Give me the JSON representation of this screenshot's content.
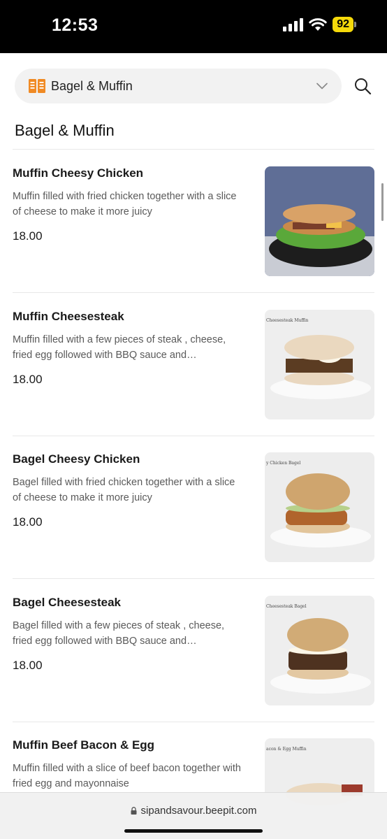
{
  "status_bar": {
    "time": "12:53",
    "battery": "92"
  },
  "header": {
    "category": "Bagel & Muffin",
    "icon": "menu-book-icon"
  },
  "section": {
    "title": "Bagel & Muffin"
  },
  "items": [
    {
      "name": "Muffin Cheesy Chicken",
      "description": "Muffin filled with fried chicken together with a slice of cheese to make it more juicy",
      "price": "18.00",
      "caption": ""
    },
    {
      "name": "Muffin Cheesesteak",
      "description": "Muffin filled with a few pieces of steak , cheese, fried egg followed with BBQ sauce and…",
      "price": "18.00",
      "caption": "Cheesesteak Muffin"
    },
    {
      "name": "Bagel Cheesy Chicken",
      "description": "Bagel filled with fried chicken together with a slice of cheese to make it more juicy",
      "price": "18.00",
      "caption": "y Chicken Bagel"
    },
    {
      "name": "Bagel Cheesesteak",
      "description": "Bagel filled with a few pieces of steak , cheese, fried egg followed with BBQ sauce and…",
      "price": "18.00",
      "caption": "Cheesesteak Bagel"
    },
    {
      "name": "Muffin Beef Bacon & Egg",
      "description": "Muffin filled with a slice of beef bacon together with fried egg and mayonnaise",
      "price": "",
      "caption": "acon & Egg Muffin"
    }
  ],
  "browser": {
    "url": "sipandsavour.beepit.com"
  },
  "colors": {
    "accent_icon": "#f08a24",
    "battery": "#f5d90a"
  }
}
